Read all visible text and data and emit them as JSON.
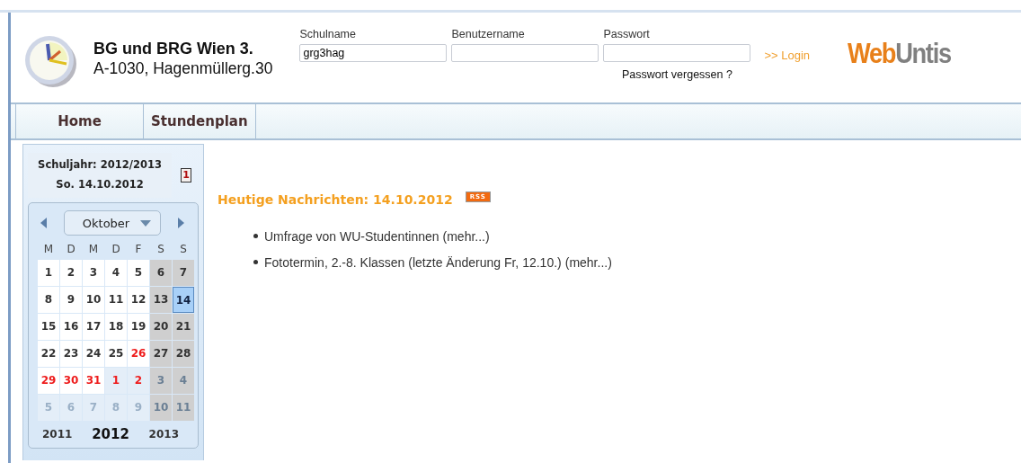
{
  "school": {
    "name": "BG und BRG Wien 3.",
    "address": "A-1030, Hagenmüllerg.30"
  },
  "login": {
    "fields": [
      {
        "label": "Schulname",
        "value": "grg3hag",
        "kind": "text"
      },
      {
        "label": "Benutzername",
        "kind": "text"
      },
      {
        "label": "Passwort",
        "kind": "password"
      }
    ],
    "forgot": "Passwort vergessen ?",
    "submit": ">> Login"
  },
  "logo": {
    "part_1": "Web",
    "part_2": "Untis"
  },
  "nav": [
    {
      "label": "Home",
      "selected": false
    },
    {
      "label": "Stundenplan",
      "selected": false
    }
  ],
  "sidebar": {
    "school_year": "Schuljahr: 2012/2013",
    "date": "So. 14.10.2012",
    "today_icon": "1",
    "calendar": {
      "month": "Oktober",
      "weekdays": [
        "M",
        "D",
        "M",
        "D",
        "F",
        "S",
        "S"
      ],
      "weeks": [
        [
          {
            "day": "1",
            "weekend": false,
            "holiday": false,
            "outside": false,
            "selected": false
          },
          {
            "day": "2",
            "weekend": false,
            "holiday": false,
            "outside": false,
            "selected": false
          },
          {
            "day": "3",
            "weekend": false,
            "holiday": false,
            "outside": false,
            "selected": false
          },
          {
            "day": "4",
            "weekend": false,
            "holiday": false,
            "outside": false,
            "selected": false
          },
          {
            "day": "5",
            "weekend": false,
            "holiday": false,
            "outside": false,
            "selected": false
          },
          {
            "day": "6",
            "weekend": true,
            "holiday": false,
            "outside": false,
            "selected": false
          },
          {
            "day": "7",
            "weekend": true,
            "holiday": false,
            "outside": false,
            "selected": false
          }
        ],
        [
          {
            "day": "8",
            "weekend": false,
            "holiday": false,
            "outside": false,
            "selected": false
          },
          {
            "day": "9",
            "weekend": false,
            "holiday": false,
            "outside": false,
            "selected": false
          },
          {
            "day": "10",
            "weekend": false,
            "holiday": false,
            "outside": false,
            "selected": false
          },
          {
            "day": "11",
            "weekend": false,
            "holiday": false,
            "outside": false,
            "selected": false
          },
          {
            "day": "12",
            "weekend": false,
            "holiday": false,
            "outside": false,
            "selected": false
          },
          {
            "day": "13",
            "weekend": true,
            "holiday": false,
            "outside": false,
            "selected": false
          },
          {
            "day": "14",
            "weekend": true,
            "holiday": false,
            "outside": false,
            "selected": true
          }
        ],
        [
          {
            "day": "15",
            "weekend": false,
            "holiday": false,
            "outside": false,
            "selected": false
          },
          {
            "day": "16",
            "weekend": false,
            "holiday": false,
            "outside": false,
            "selected": false
          },
          {
            "day": "17",
            "weekend": false,
            "holiday": false,
            "outside": false,
            "selected": false
          },
          {
            "day": "18",
            "weekend": false,
            "holiday": false,
            "outside": false,
            "selected": false
          },
          {
            "day": "19",
            "weekend": false,
            "holiday": false,
            "outside": false,
            "selected": false
          },
          {
            "day": "20",
            "weekend": true,
            "holiday": false,
            "outside": false,
            "selected": false
          },
          {
            "day": "21",
            "weekend": true,
            "holiday": false,
            "outside": false,
            "selected": false
          }
        ],
        [
          {
            "day": "22",
            "weekend": false,
            "holiday": false,
            "outside": false,
            "selected": false
          },
          {
            "day": "23",
            "weekend": false,
            "holiday": false,
            "outside": false,
            "selected": false
          },
          {
            "day": "24",
            "weekend": false,
            "holiday": false,
            "outside": false,
            "selected": false
          },
          {
            "day": "25",
            "weekend": false,
            "holiday": false,
            "outside": false,
            "selected": false
          },
          {
            "day": "26",
            "weekend": false,
            "holiday": true,
            "outside": false,
            "selected": false
          },
          {
            "day": "27",
            "weekend": true,
            "holiday": false,
            "outside": false,
            "selected": false
          },
          {
            "day": "28",
            "weekend": true,
            "holiday": false,
            "outside": false,
            "selected": false
          }
        ],
        [
          {
            "day": "29",
            "weekend": false,
            "holiday": true,
            "outside": false,
            "selected": false
          },
          {
            "day": "30",
            "weekend": false,
            "holiday": true,
            "outside": false,
            "selected": false
          },
          {
            "day": "31",
            "weekend": false,
            "holiday": true,
            "outside": false,
            "selected": false
          },
          {
            "day": "1",
            "weekend": false,
            "holiday": true,
            "outside": true,
            "selected": false
          },
          {
            "day": "2",
            "weekend": false,
            "holiday": true,
            "outside": true,
            "selected": false
          },
          {
            "day": "3",
            "weekend": true,
            "holiday": false,
            "outside": true,
            "selected": false
          },
          {
            "day": "4",
            "weekend": true,
            "holiday": false,
            "outside": true,
            "selected": false
          }
        ],
        [
          {
            "day": "5",
            "weekend": false,
            "holiday": false,
            "outside": true,
            "selected": false
          },
          {
            "day": "6",
            "weekend": false,
            "holiday": false,
            "outside": true,
            "selected": false
          },
          {
            "day": "7",
            "weekend": false,
            "holiday": false,
            "outside": true,
            "selected": false
          },
          {
            "day": "8",
            "weekend": false,
            "holiday": false,
            "outside": true,
            "selected": false
          },
          {
            "day": "9",
            "weekend": false,
            "holiday": false,
            "outside": true,
            "selected": false
          },
          {
            "day": "10",
            "weekend": true,
            "holiday": false,
            "outside": true,
            "selected": false
          },
          {
            "day": "11",
            "weekend": true,
            "holiday": false,
            "outside": true,
            "selected": false
          }
        ]
      ],
      "years": [
        {
          "label": "2011",
          "selected": false
        },
        {
          "label": "2012",
          "selected": true
        },
        {
          "label": "2013",
          "selected": false
        }
      ]
    }
  },
  "news": {
    "title": "Heutige Nachrichten: 14.10.2012",
    "feed_badge": "RSS",
    "items": [
      {
        "text": "Umfrage von WU-Studentinnen",
        "more": "(mehr...)"
      },
      {
        "text": "Fototermin, 2.-8. Klassen (letzte Änderung Fr, 12.10.)",
        "more": "(mehr...)"
      }
    ]
  }
}
